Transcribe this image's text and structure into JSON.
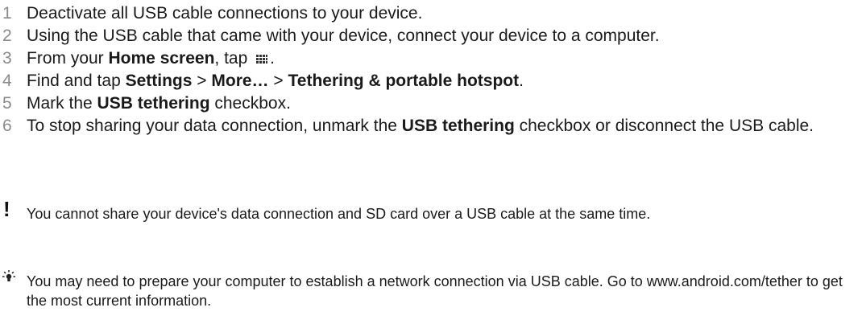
{
  "steps": [
    {
      "num": "1",
      "text": "Deactivate all USB cable connections to your device."
    },
    {
      "num": "2",
      "text": "Using the USB cable that came with your device, connect your device to a computer."
    },
    {
      "num": "3",
      "pre": "From your ",
      "bold": "Home screen",
      "mid": ", tap ",
      "icon": "apps-grid-icon",
      "post": "."
    },
    {
      "num": "4",
      "pre": "Find and tap ",
      "b1": "Settings",
      "s1": " > ",
      "b2": "More…",
      "s2": " > ",
      "b3": "Tethering & portable hotspot",
      "post": "."
    },
    {
      "num": "5",
      "pre": "Mark the ",
      "bold": "USB tethering",
      "post": " checkbox."
    },
    {
      "num": "6",
      "pre": "To stop sharing your data connection, unmark the ",
      "bold": "USB tethering",
      "post": " checkbox or disconnect the USB cable."
    }
  ],
  "notes": {
    "warning": {
      "icon": "exclamation-icon",
      "text": "You cannot share your device's data connection and SD card over a USB cable at the same time."
    },
    "tip": {
      "icon": "lightbulb-icon",
      "text": "You may need to prepare your computer to establish a network connection via USB cable. Go to www.android.com/tether to get the most current information."
    }
  }
}
